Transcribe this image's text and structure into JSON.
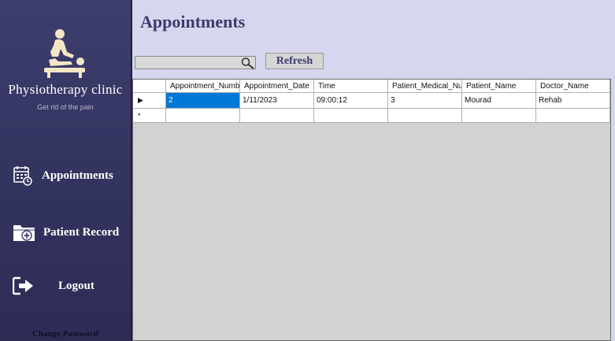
{
  "sidebar": {
    "clinic_name": "Physiotherapy clinic",
    "tagline": "Get rid of the pain",
    "logo_icon": "physiotherapy-massage-icon",
    "nav": [
      {
        "label": "Appointments",
        "icon": "calendar-icon"
      },
      {
        "label": "Patient Record",
        "icon": "medical-folder-icon"
      },
      {
        "label": "Logout",
        "icon": "logout-arrow-icon"
      }
    ],
    "change_password": "Change Password"
  },
  "main": {
    "title": "Appointments",
    "search": {
      "value": "",
      "placeholder": ""
    },
    "refresh_label": "Refresh"
  },
  "grid": {
    "columns": [
      "Appointment_Number",
      "Appointment_Date",
      "Time",
      "Patient_Medical_Numb",
      "Patient_Name",
      "Doctor_Name"
    ],
    "rows": [
      {
        "indicator": "▶",
        "cells": [
          "2",
          "1/11/2023",
          "09:00:12",
          "3",
          "Mourad",
          "Rehab"
        ]
      }
    ],
    "new_row_indicator": "*"
  },
  "colors": {
    "sidebar_bg": "#3e3e6e",
    "main_bg": "#d6d6ee",
    "title_color": "#3b3b6b",
    "selection": "#0078d7"
  }
}
